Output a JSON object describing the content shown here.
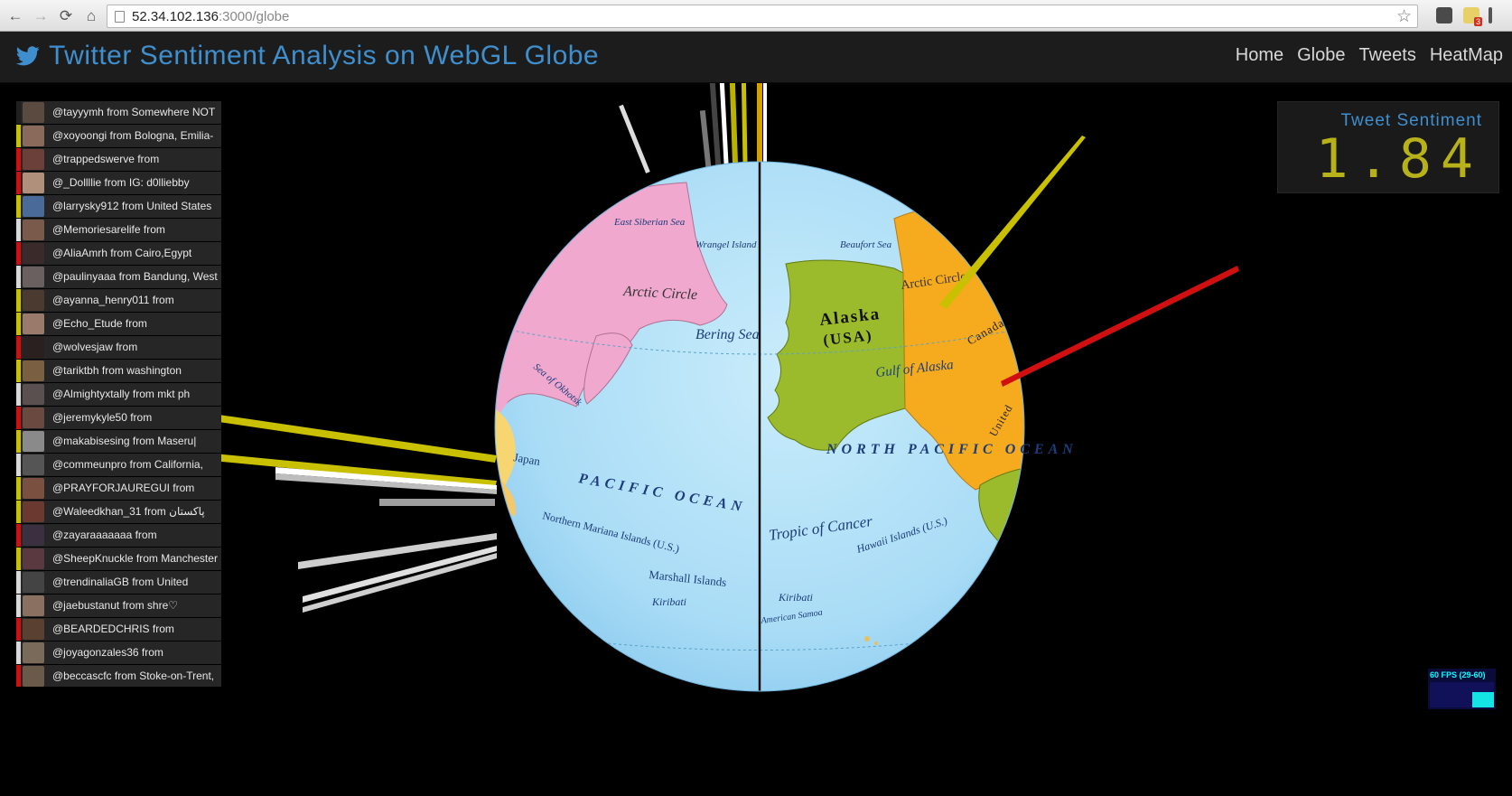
{
  "browser": {
    "url_host": "52.34.102.136",
    "url_rest": ":3000/globe",
    "extension_badge": "3"
  },
  "app": {
    "title": "Twitter Sentiment Analysis on WebGL Globe",
    "nav": [
      "Home",
      "Globe",
      "Tweets",
      "HeatMap"
    ]
  },
  "sentiment": {
    "label": "Tweet Sentiment",
    "value": "1.84"
  },
  "tweets": [
    {
      "text": "@tayyymh from Somewhere NOT",
      "color": "#1f1f1f"
    },
    {
      "text": "@xoyoongi from Bologna, Emilia-",
      "color": "#c8c000"
    },
    {
      "text": "@trappedswerve from",
      "color": "#d01010"
    },
    {
      "text": "@_Dollllie from IG: d0lliebby",
      "color": "#d01010"
    },
    {
      "text": "@larrysky912 from United States",
      "color": "#c8c000"
    },
    {
      "text": "@Memoriesarelife from",
      "color": "#d8d8d8"
    },
    {
      "text": "@AliaAmrh from Cairo,Egypt",
      "color": "#d01010"
    },
    {
      "text": "@paulinyaaa from Bandung, West",
      "color": "#d8d8d8"
    },
    {
      "text": "@ayanna_henry011 from",
      "color": "#c8c000"
    },
    {
      "text": "@Echo_Etude from",
      "color": "#c8c000"
    },
    {
      "text": "@wolvesjaw from",
      "color": "#d01010"
    },
    {
      "text": "@tariktbh from washington",
      "color": "#c8c000"
    },
    {
      "text": "@Almightyxtally from mkt ph",
      "color": "#d8d8d8"
    },
    {
      "text": "@jeremykyle50 from",
      "color": "#d01010"
    },
    {
      "text": "@makabisesing from Maseru|",
      "color": "#c8c000"
    },
    {
      "text": "@commeunpro from California,",
      "color": "#d8d8d8"
    },
    {
      "text": "@PRAYFORJAUREGUI from",
      "color": "#c8c000"
    },
    {
      "text": "@Waleedkhan_31 from پاکستان",
      "color": "#c8c000"
    },
    {
      "text": "@zayaraaaaaaa from",
      "color": "#d01010"
    },
    {
      "text": "@SheepKnuckle from Manchester",
      "color": "#c8c000"
    },
    {
      "text": "@trendinaliaGB from United",
      "color": "#d8d8d8"
    },
    {
      "text": "@jaebustanut from shre♡",
      "color": "#d8d8d8"
    },
    {
      "text": "@BEARDEDCHRIS from",
      "color": "#d01010"
    },
    {
      "text": "@joyagonzales36 from",
      "color": "#d8d8d8"
    },
    {
      "text": "@beccascfc from Stoke-on-Trent,",
      "color": "#d01010"
    }
  ],
  "globe": {
    "labels": {
      "east_siberian_sea": "East Siberian Sea",
      "wrangel_island": "Wrangel Island",
      "beaufort_sea": "Beaufort Sea",
      "arctic_circle_left": "Arctic Circle",
      "arctic_circle_right": "Arctic Circle",
      "alaska": "Alaska",
      "alaska_usa": "(USA)",
      "canada": "Canada",
      "bering_sea": "Bering Sea",
      "sea_of_okhotsk": "Sea of Okhotsk",
      "gulf_of_alaska": "Gulf of Alaska",
      "north_pacific_ocean": "NORTH PACIFIC OCEAN",
      "pacific_ocean": "PACIFIC OCEAN",
      "japan": "Japan",
      "tropic_of_cancer": "Tropic of Cancer",
      "hawaii": "Hawaii Islands (U.S.)",
      "northern_mariana": "Northern Mariana Islands (U.S.)",
      "marshall_islands": "Marshall Islands",
      "kiribati_left": "Kiribati",
      "kiribati_right": "Kiribati",
      "american_samoa": "American Samoa",
      "united_states": "United"
    }
  },
  "fps": {
    "text": "60 FPS (29-60)",
    "level": 0.6
  },
  "colors": {
    "positive": "#c8c000",
    "negative": "#d01010",
    "neutral": "#d8d8d8",
    "accent": "#3f8fce"
  }
}
